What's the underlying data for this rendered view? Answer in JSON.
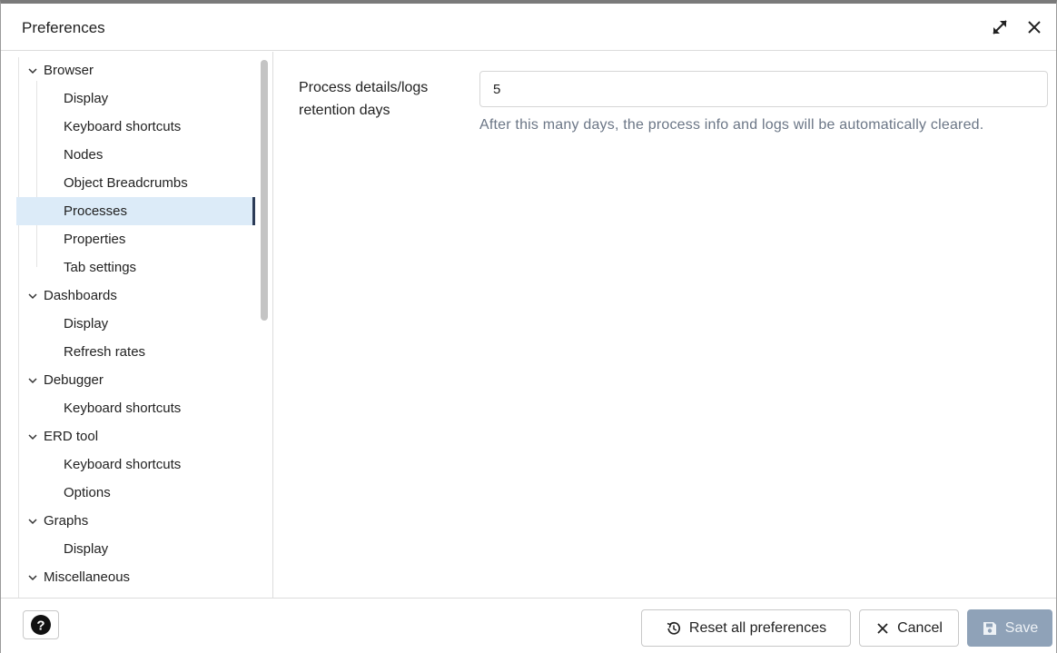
{
  "dialog": {
    "title": "Preferences"
  },
  "tree": {
    "groups": [
      {
        "label": "Browser",
        "children": [
          "Display",
          "Keyboard shortcuts",
          "Nodes",
          "Object Breadcrumbs",
          "Processes",
          "Properties",
          "Tab settings"
        ]
      },
      {
        "label": "Dashboards",
        "children": [
          "Display",
          "Refresh rates"
        ]
      },
      {
        "label": "Debugger",
        "children": [
          "Keyboard shortcuts"
        ]
      },
      {
        "label": "ERD tool",
        "children": [
          "Keyboard shortcuts",
          "Options"
        ]
      },
      {
        "label": "Graphs",
        "children": [
          "Display"
        ]
      },
      {
        "label": "Miscellaneous",
        "children": []
      }
    ],
    "selected": "Browser/Processes"
  },
  "field": {
    "label": "Process details/logs retention days",
    "value": "5",
    "help": "After this many days, the process info and logs will be automatically cleared."
  },
  "footer": {
    "reset_label": "Reset all preferences",
    "cancel_label": "Cancel",
    "save_label": "Save"
  },
  "colors": {
    "selected_bg": "#dcebf8",
    "selected_marker": "#2b3b57",
    "save_disabled_bg": "#8fa2b8",
    "help_text": "#6b7686"
  },
  "icons": {
    "expand": "expand-arrows-icon",
    "close": "close-icon",
    "chevron": "chevron-down-icon",
    "help": "question-circle-icon",
    "reset": "reset-history-icon",
    "cancel": "x-icon",
    "save": "floppy-disk-icon"
  }
}
